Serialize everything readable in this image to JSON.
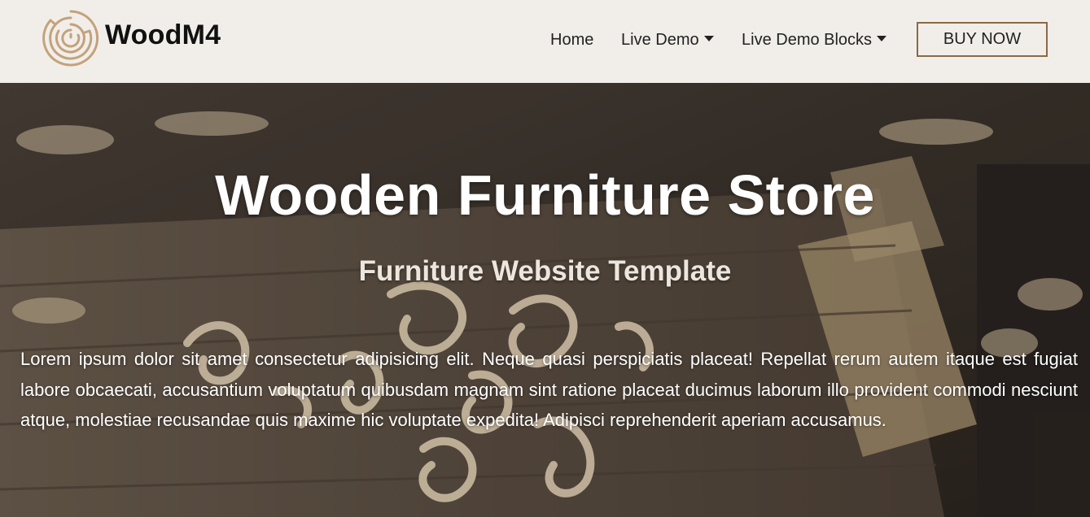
{
  "header": {
    "brand": "WoodM4",
    "logo_icon": "concentric-maze-logo-icon",
    "nav": {
      "home": "Home",
      "live_demo": "Live Demo",
      "live_demo_blocks": "Live Demo Blocks"
    },
    "buy_now": "BUY NOW"
  },
  "hero": {
    "title": "Wooden Furniture Store",
    "subtitle": "Furniture Website Template",
    "text": "Lorem ipsum dolor sit amet consectetur adipisicing elit. Neque quasi perspiciatis placeat! Repellat rerum autem itaque est fugiat labore obcaecati, accusantium voluptatum quibusdam magnam sint ratione placeat ducimus laborum illo provident commodi nesciunt atque, molestiae recusandae quis maxime hic voluptate expedita! Adipisci reprehenderit aperiam accusamus."
  },
  "colors": {
    "header_bg": "#f1eeea",
    "accent": "#8a6a43",
    "logo": "#c4a27a"
  }
}
